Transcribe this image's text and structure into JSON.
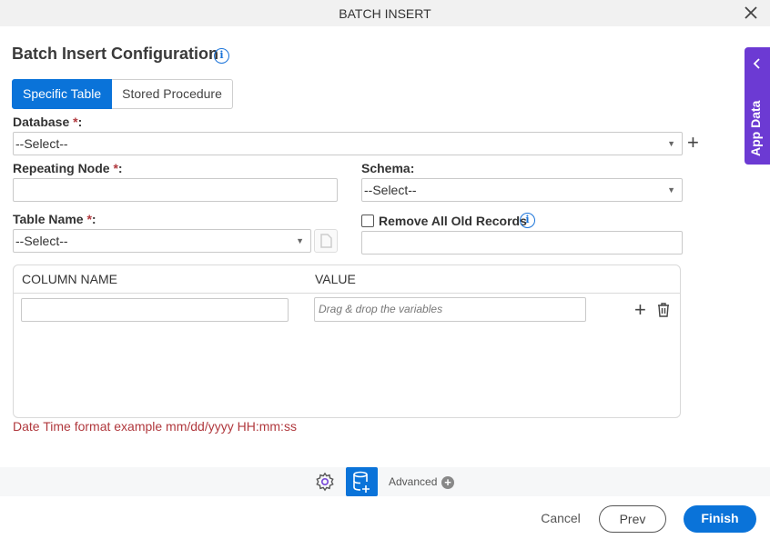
{
  "dialog": {
    "title": "BATCH INSERT"
  },
  "heading": "Batch Insert Configuration",
  "tabs": [
    {
      "label": "Specific Table",
      "active": true
    },
    {
      "label": "Stored Procedure",
      "active": false
    }
  ],
  "fields": {
    "database": {
      "label": "Database",
      "required_mark": "*",
      "suffix": ":",
      "value": "--Select--"
    },
    "repeating_node": {
      "label": "Repeating Node",
      "required_mark": "*",
      "suffix": ":",
      "value": ""
    },
    "schema": {
      "label": "Schema:",
      "value": "--Select--"
    },
    "table_name": {
      "label": "Table Name",
      "required_mark": "*",
      "suffix": ":",
      "value": "--Select--"
    },
    "remove_old": {
      "label": "Remove All Old Records",
      "checked": false,
      "value": ""
    }
  },
  "grid": {
    "columns": [
      "COLUMN NAME",
      "VALUE"
    ],
    "rows": [
      {
        "column_name": "",
        "value_placeholder": "Drag & drop the variables"
      }
    ]
  },
  "hint": "Date Time format example mm/dd/yyyy HH:mm:ss",
  "toolbar": {
    "advanced_label": "Advanced"
  },
  "footer": {
    "cancel": "Cancel",
    "prev": "Prev",
    "finish": "Finish"
  },
  "side_panel": {
    "label": "App Data"
  },
  "colors": {
    "primary": "#0a73d9",
    "side_panel": "#6c3ad3",
    "required": "#b0383d"
  }
}
